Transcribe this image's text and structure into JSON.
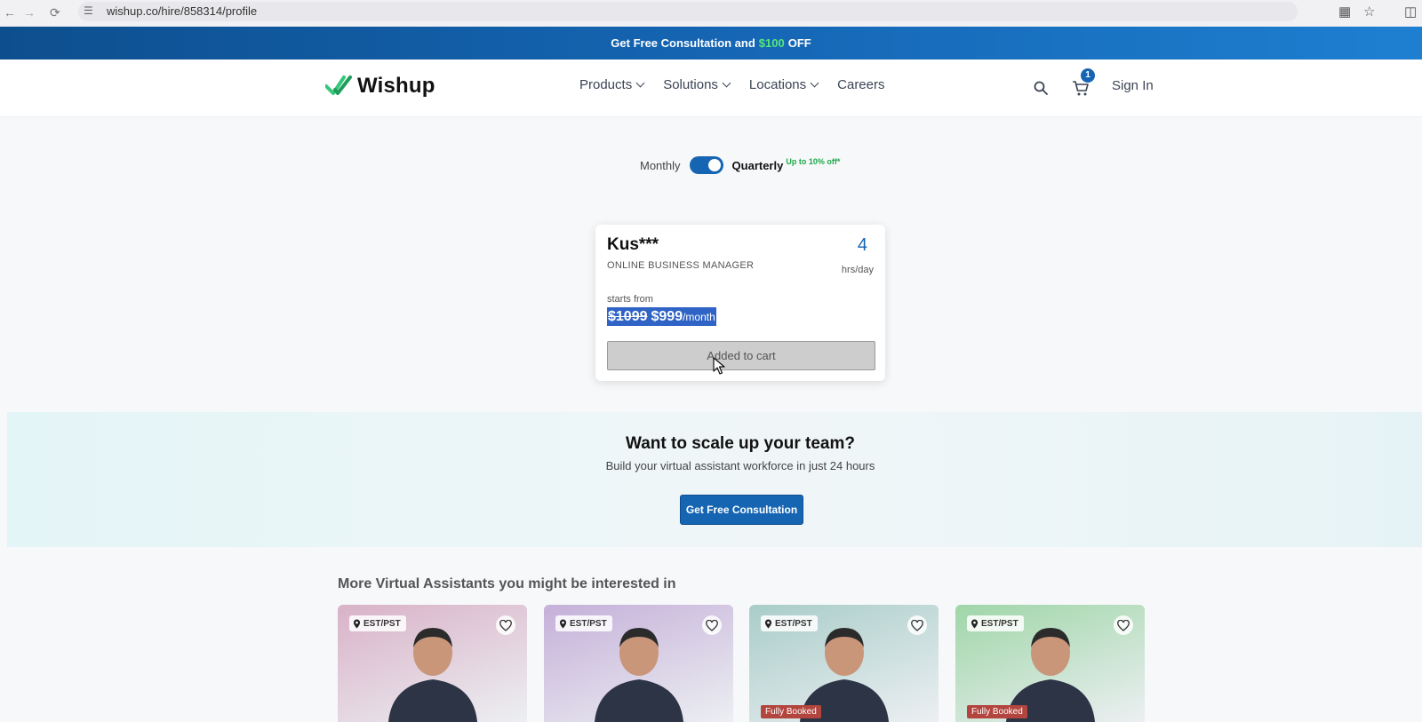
{
  "browser": {
    "url": "wishup.co/hire/858314/profile"
  },
  "promo": {
    "text_before": "Get Free Consultation and",
    "amount": "$100",
    "text_after": "OFF"
  },
  "header": {
    "logo_text": "Wishup",
    "nav": [
      {
        "label": "Products"
      },
      {
        "label": "Solutions"
      },
      {
        "label": "Locations"
      },
      {
        "label": "Careers"
      }
    ],
    "cart_count": "1",
    "sign_in": "Sign In"
  },
  "billing": {
    "monthly_label": "Monthly",
    "quarterly_label": "Quarterly",
    "discount_note": "Up to 10% off*",
    "quarterly_selected": true
  },
  "profile_card": {
    "name": "Kus***",
    "role": "ONLINE BUSINESS MANAGER",
    "hours_value": "4",
    "hours_unit": "hrs/day",
    "starts_from": "starts from",
    "old_price": "$1099",
    "new_price": "$999",
    "price_period": "/month",
    "cart_button": "Added to cart"
  },
  "scale": {
    "title": "Want to scale up your team?",
    "subtitle": "Build your virtual assistant workforce in just 24 hours",
    "button": "Get Free Consultation"
  },
  "more": {
    "title": "More Virtual Assistants you might be interested in",
    "cards": [
      {
        "timezone": "EST/PST",
        "booked": "",
        "bg": "#d9b2c8"
      },
      {
        "timezone": "EST/PST",
        "booked": "",
        "bg": "#c5b0d9"
      },
      {
        "timezone": "EST/PST",
        "booked": "Fully Booked",
        "bg": "#a9cdc9"
      },
      {
        "timezone": "EST/PST",
        "booked": "Fully Booked",
        "bg": "#9fd6a8"
      }
    ]
  },
  "colors": {
    "brand_blue": "#1565b3",
    "accent_green": "#54e87a",
    "discount_green": "#1ea84a",
    "booked_red": "#b3453f"
  },
  "icons": [
    "back-arrow-icon",
    "forward-arrow-icon",
    "reload-icon",
    "site-info-icon",
    "install-icon",
    "star-icon",
    "extensions-icon",
    "search-icon",
    "cart-icon",
    "location-pin-icon",
    "heart-icon",
    "cursor-icon"
  ]
}
